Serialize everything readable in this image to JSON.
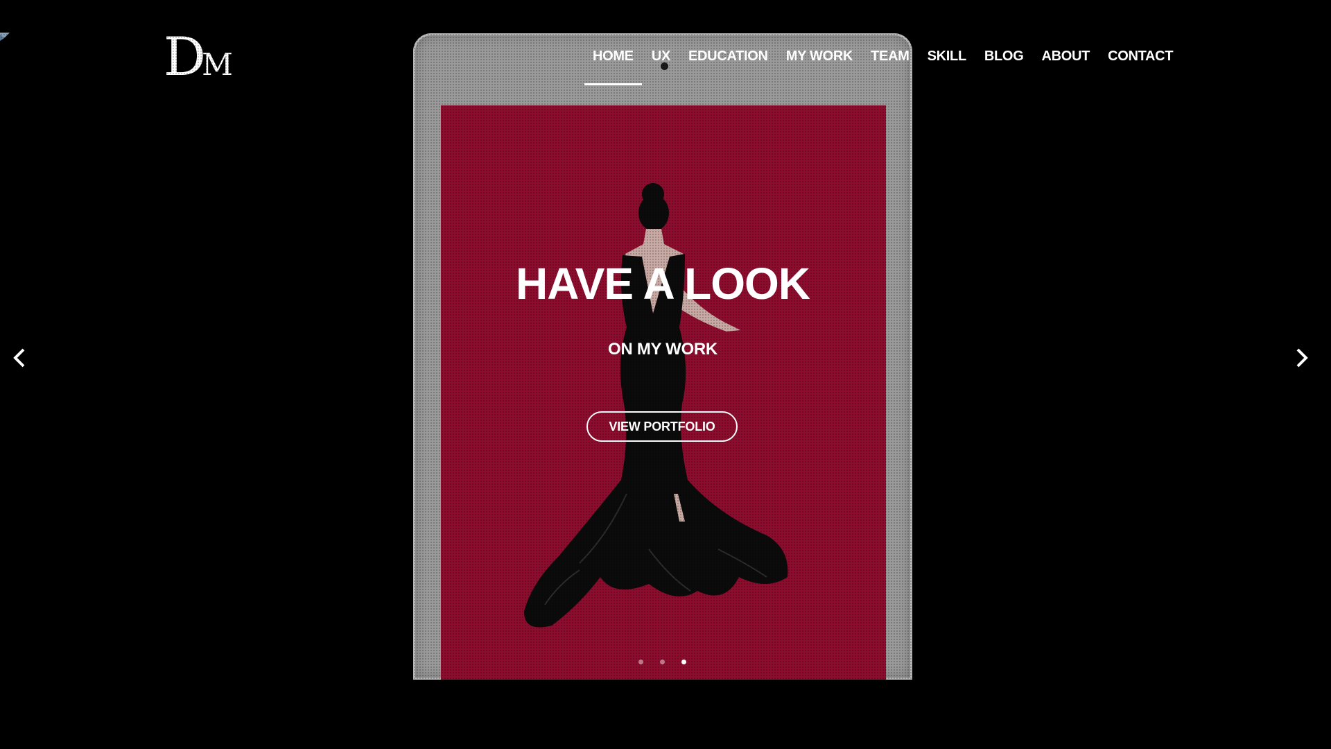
{
  "logo": {
    "big": "D",
    "small": "M"
  },
  "nav": {
    "items": [
      {
        "label": "HOME"
      },
      {
        "label": "UX"
      },
      {
        "label": "EDUCATION"
      },
      {
        "label": "MY WORK"
      },
      {
        "label": "TEAM"
      },
      {
        "label": "SKILL"
      },
      {
        "label": "BLOG"
      },
      {
        "label": "ABOUT"
      },
      {
        "label": "CONTACT"
      }
    ],
    "active_index": 0
  },
  "hero": {
    "title": "HAVE A LOOK",
    "subtitle": "ON MY WORK",
    "cta_label": "VIEW PORTFOLIO"
  },
  "carousel": {
    "prev_icon": "chevron-left-icon",
    "next_icon": "chevron-right-icon",
    "slide_count": 3,
    "active_slide": 3
  },
  "colors": {
    "background": "#000000",
    "tablet_frame": "#9a9a9a",
    "screen": "#8c0d2d",
    "text": "#ffffff"
  }
}
